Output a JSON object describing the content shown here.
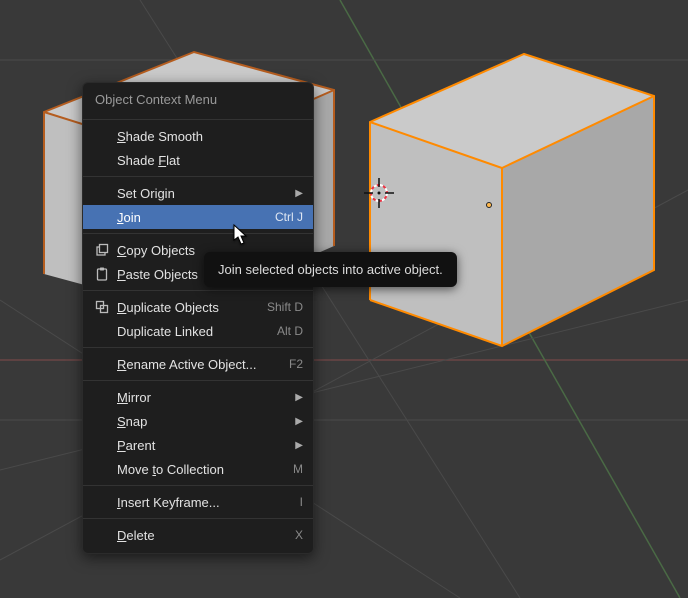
{
  "menu": {
    "title": "Object Context Menu",
    "items": {
      "shade_smooth": {
        "label": "Shade Smooth",
        "u": "S"
      },
      "shade_flat": {
        "label": "Shade Flat",
        "u": "F"
      },
      "set_origin": {
        "label": "Set Origin",
        "submenu": true
      },
      "join": {
        "label": "Join",
        "shortcut": "Ctrl J",
        "u": "J"
      },
      "copy": {
        "label": "Copy Objects",
        "u": "C"
      },
      "paste": {
        "label": "Paste Objects",
        "u": "P"
      },
      "duplicate": {
        "label": "Duplicate Objects",
        "u": "D",
        "shortcut": "Shift D"
      },
      "duplicate_linked": {
        "label": "Duplicate Linked",
        "shortcut": "Alt D"
      },
      "rename": {
        "label": "Rename Active Object...",
        "u": "R",
        "shortcut": "F2"
      },
      "mirror": {
        "label": "Mirror",
        "u": "M",
        "submenu": true
      },
      "snap": {
        "label": "Snap",
        "u": "S",
        "submenu": true
      },
      "parent": {
        "label": "Parent",
        "u": "P",
        "submenu": true
      },
      "move_to_collection": {
        "label": "Move to Collection",
        "u": "t",
        "shortcut": "M"
      },
      "insert_keyframe": {
        "label": "Insert Keyframe...",
        "u": "I",
        "shortcut": "I"
      },
      "delete": {
        "label": "Delete",
        "u": "D",
        "shortcut": "X"
      }
    }
  },
  "tooltip": {
    "text": "Join selected objects into active object."
  }
}
